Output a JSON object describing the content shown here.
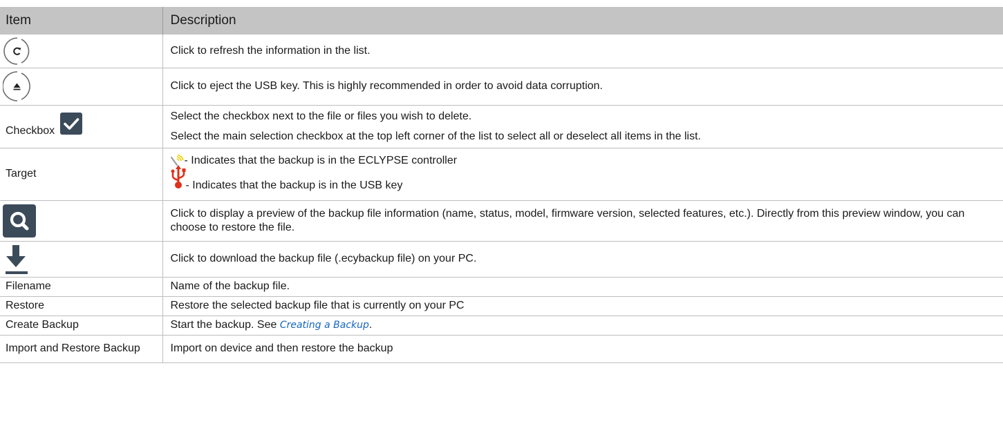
{
  "header": {
    "item": "Item",
    "description": "Description"
  },
  "rows": {
    "refresh": {
      "icon": "refresh-icon",
      "description": "Click to refresh the information in the list."
    },
    "eject": {
      "icon": "eject-icon",
      "description": "Click to eject the USB key. This is highly recommended in order to avoid data corruption."
    },
    "checkbox": {
      "item": "Checkbox",
      "icon": "checkbox-checked-icon",
      "description_1": "Select the checkbox next to the file or files you wish to delete.",
      "description_2": "Select the main selection checkbox at the top left corner of the list to select all or deselect all items in the list."
    },
    "target": {
      "item": "Target",
      "controller_icon": "wireless-controller-icon",
      "usb_icon": "usb-icon",
      "description_controller": "- Indicates that the backup is in the ECLYPSE controller",
      "description_usb": "- Indicates that the backup is in the USB key"
    },
    "preview": {
      "icon": "magnifier-icon",
      "description": "Click to display a preview of the backup file information (name, status, model, firmware version, selected features, etc.). Directly from this preview window, you can choose to restore the file."
    },
    "download": {
      "icon": "download-icon",
      "description": "Click to download the backup file (.ecybackup file) on your PC."
    },
    "filename": {
      "item": "Filename",
      "description": "Name of the backup file."
    },
    "restore": {
      "item": "Restore",
      "description": "Restore the selected backup file that is currently on your PC"
    },
    "create_backup": {
      "item": "Create Backup",
      "description": "Start the backup. See ",
      "link": "Creating a Backup",
      "suffix": "."
    },
    "import_restore": {
      "item": "Import and Restore Backup",
      "description": "Import on device and then restore the backup"
    }
  },
  "colors": {
    "header_bg": "#c4c4c4",
    "border": "#bdbdbd",
    "link": "#1565c0",
    "usb_red": "#e0311a",
    "icon_dark": "#3c4b5a"
  }
}
